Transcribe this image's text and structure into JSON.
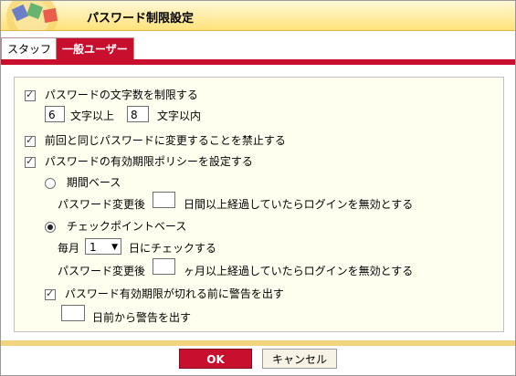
{
  "window": {
    "title": "パスワード制限設定"
  },
  "tabs": [
    {
      "label": "スタッフ",
      "active": false
    },
    {
      "label": "一般ユーザー",
      "active": true
    }
  ],
  "settings": {
    "limit_length": {
      "label": "パスワードの文字数を制限する",
      "checked": true,
      "min_value": "6",
      "min_label": "文字以上",
      "max_value": "8",
      "max_label": "文字以内"
    },
    "no_reuse": {
      "label": "前回と同じパスワードに変更することを禁止する",
      "checked": true
    },
    "expiry_policy": {
      "label": "パスワードの有効期限ポリシーを設定する",
      "checked": true,
      "period": {
        "label": "期間ベース",
        "checked": false,
        "prefix": "パスワード変更後",
        "value": "",
        "suffix": "日間以上経過していたらログインを無効とする"
      },
      "checkpoint": {
        "label": "チェックポイントベース",
        "checked": true,
        "monthly_prefix": "毎月",
        "day": "1",
        "monthly_suffix": "日にチェックする",
        "after_prefix": "パスワード変更後",
        "months_value": "",
        "after_suffix": "ヶ月以上経過していたらログインを無効とする"
      },
      "warn": {
        "label": "パスワード有効期限が切れる前に警告を出す",
        "checked": true,
        "days_value": "",
        "days_suffix": "日前から警告を出す"
      }
    }
  },
  "buttons": {
    "ok": "OK",
    "cancel": "キャンセル"
  },
  "colors": {
    "accent": "#c8102e",
    "header": "#ffe27a",
    "panel": "#fffff0"
  },
  "icons": {
    "logo": "app-logo-icon"
  }
}
